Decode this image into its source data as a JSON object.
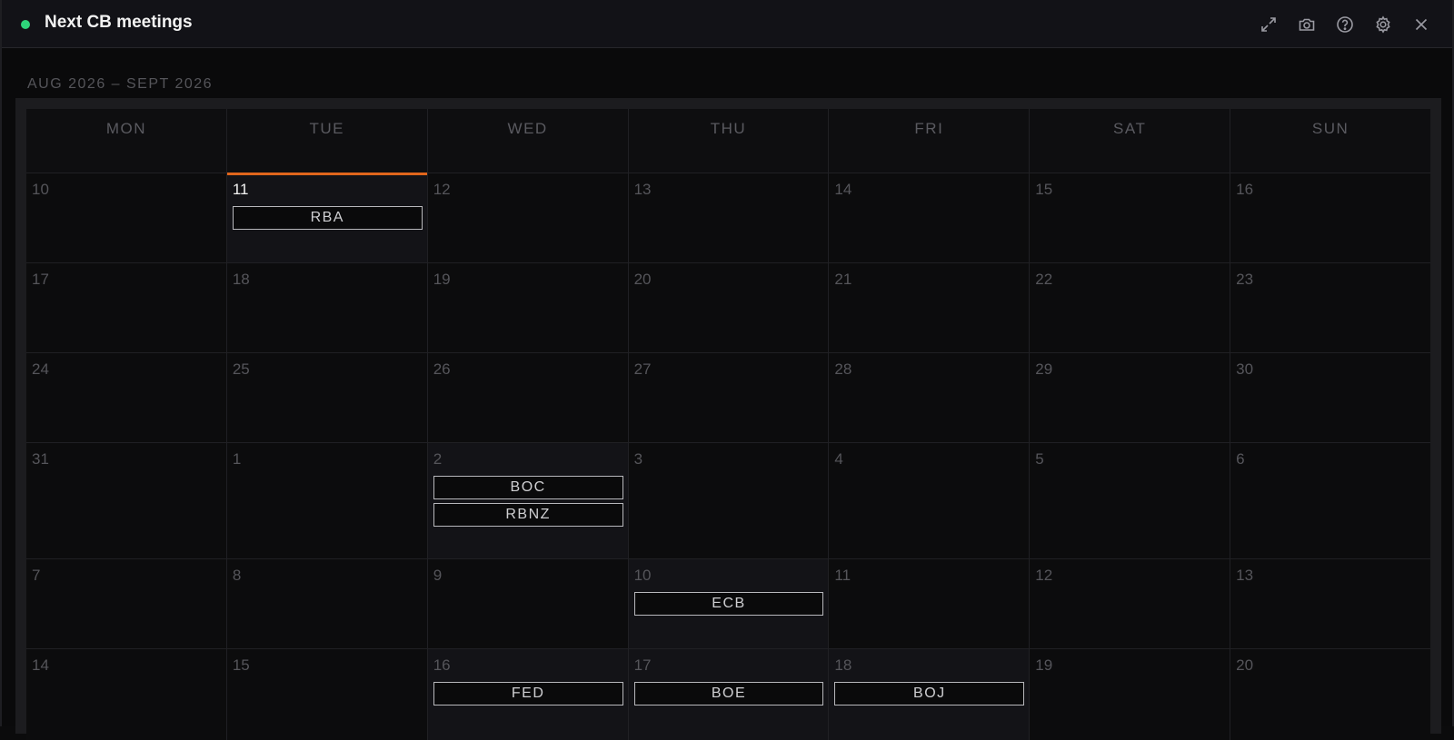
{
  "window": {
    "title": "Next CB meetings",
    "status_color": "#2ed47a"
  },
  "toolbar": {
    "icons": [
      "expand-icon",
      "camera-icon",
      "help-icon",
      "gear-icon",
      "close-icon"
    ]
  },
  "calendar": {
    "range_label": "AUG 2026 – SEPT 2026",
    "accent_color": "#e0661c",
    "weekdays": [
      "MON",
      "TUE",
      "WED",
      "THU",
      "FRI",
      "SAT",
      "SUN"
    ],
    "weeks": [
      [
        {
          "day": "10",
          "events": []
        },
        {
          "day": "11",
          "events": [
            "RBA"
          ],
          "today": true
        },
        {
          "day": "12",
          "events": []
        },
        {
          "day": "13",
          "events": []
        },
        {
          "day": "14",
          "events": []
        },
        {
          "day": "15",
          "events": []
        },
        {
          "day": "16",
          "events": []
        }
      ],
      [
        {
          "day": "17",
          "events": []
        },
        {
          "day": "18",
          "events": []
        },
        {
          "day": "19",
          "events": []
        },
        {
          "day": "20",
          "events": []
        },
        {
          "day": "21",
          "events": []
        },
        {
          "day": "22",
          "events": []
        },
        {
          "day": "23",
          "events": []
        }
      ],
      [
        {
          "day": "24",
          "events": []
        },
        {
          "day": "25",
          "events": []
        },
        {
          "day": "26",
          "events": []
        },
        {
          "day": "27",
          "events": []
        },
        {
          "day": "28",
          "events": []
        },
        {
          "day": "29",
          "events": []
        },
        {
          "day": "30",
          "events": []
        }
      ],
      [
        {
          "day": "31",
          "events": []
        },
        {
          "day": "1",
          "events": []
        },
        {
          "day": "2",
          "events": [
            "BOC",
            "RBNZ"
          ]
        },
        {
          "day": "3",
          "events": []
        },
        {
          "day": "4",
          "events": []
        },
        {
          "day": "5",
          "events": []
        },
        {
          "day": "6",
          "events": []
        }
      ],
      [
        {
          "day": "7",
          "events": []
        },
        {
          "day": "8",
          "events": []
        },
        {
          "day": "9",
          "events": []
        },
        {
          "day": "10",
          "events": [
            "ECB"
          ]
        },
        {
          "day": "11",
          "events": []
        },
        {
          "day": "12",
          "events": []
        },
        {
          "day": "13",
          "events": []
        }
      ],
      [
        {
          "day": "14",
          "events": []
        },
        {
          "day": "15",
          "events": []
        },
        {
          "day": "16",
          "events": [
            "FED"
          ]
        },
        {
          "day": "17",
          "events": [
            "BOE"
          ]
        },
        {
          "day": "18",
          "events": [
            "BOJ"
          ]
        },
        {
          "day": "19",
          "events": []
        },
        {
          "day": "20",
          "events": []
        }
      ]
    ]
  }
}
